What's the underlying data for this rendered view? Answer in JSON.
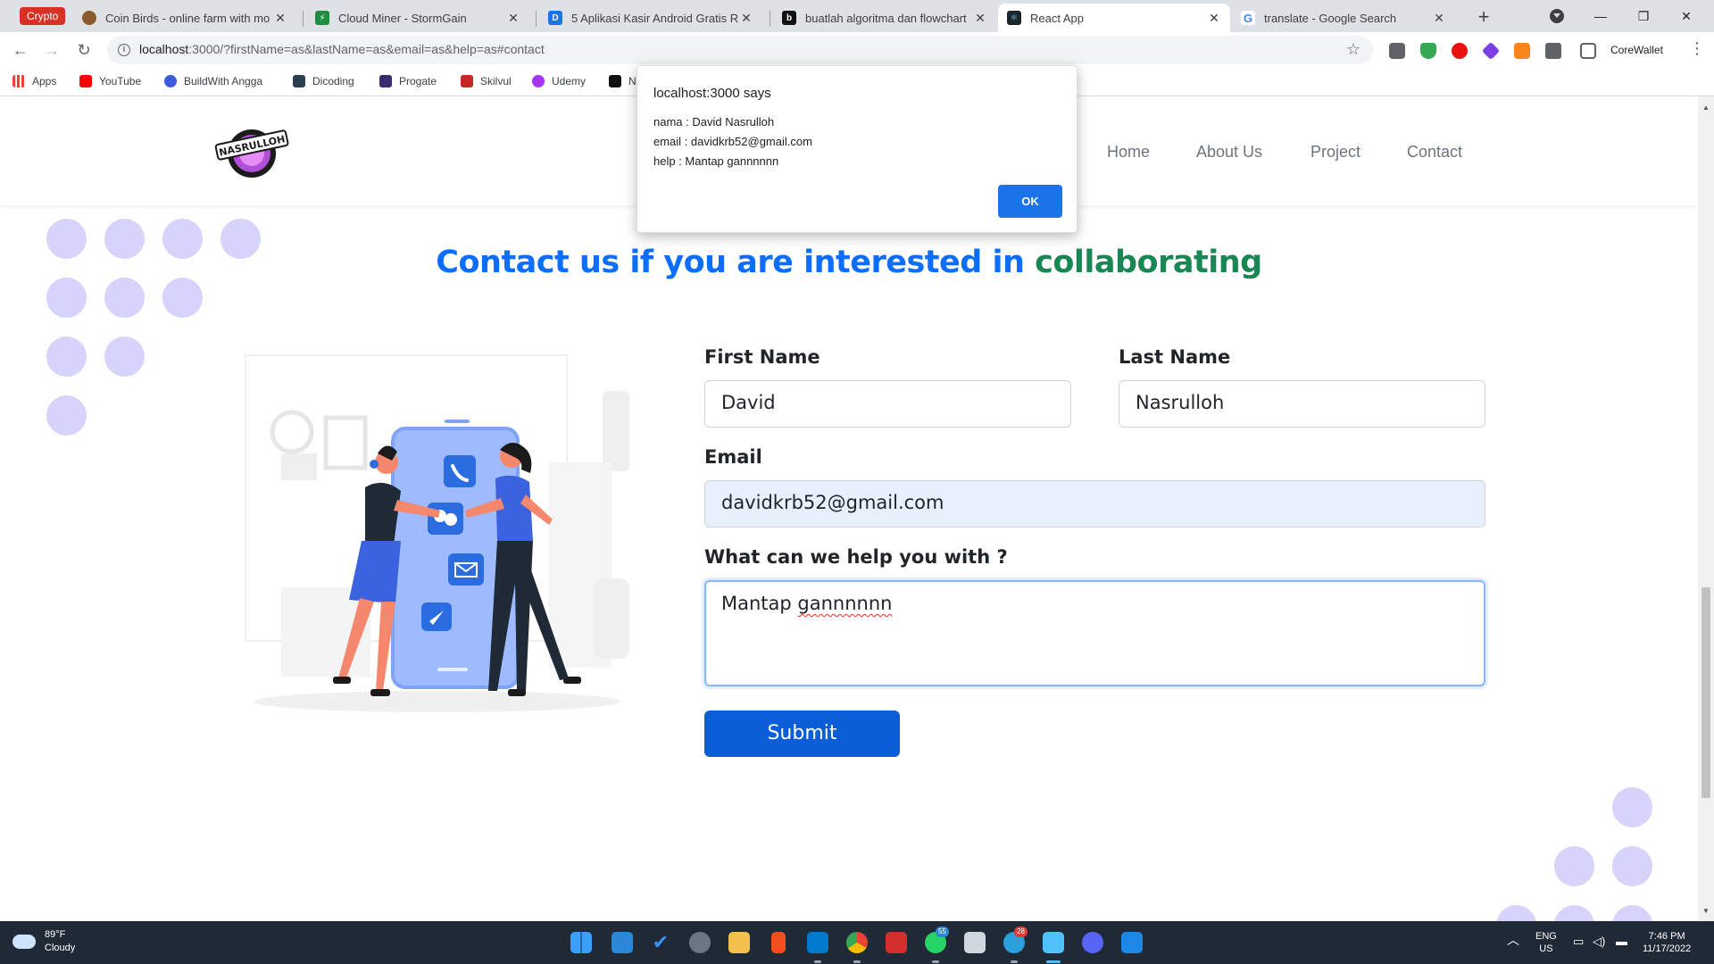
{
  "browser": {
    "tab_group": "Crypto",
    "tabs": [
      {
        "title": "Coin Birds - online farm with mo",
        "favicon_color": "#8b5a2b"
      },
      {
        "title": "Cloud Miner - StormGain",
        "favicon_color": "#1e8e3e"
      },
      {
        "title": "5 Aplikasi Kasir Android Gratis R",
        "favicon_color": "#1a73e8"
      },
      {
        "title": "buatlah algoritma dan flowchart",
        "favicon_color": "#111111"
      },
      {
        "title": "React App",
        "favicon_color": "#20232a"
      },
      {
        "title": "translate - Google Search",
        "favicon_color": "#4285f4"
      }
    ],
    "url_host": "localhost",
    "url_rest": ":3000/?firstName=as&lastName=as&email=as&help=as#contact",
    "profile_label": "CoreWallet",
    "bookmarks": [
      {
        "label": "Apps",
        "color": "#ea4335"
      },
      {
        "label": "YouTube",
        "color": "#ff0000"
      },
      {
        "label": "BuildWith Angga",
        "color": "#3b5bdb"
      },
      {
        "label": "Dicoding",
        "color": "#2d3e50"
      },
      {
        "label": "Progate",
        "color": "#3a2a6d"
      },
      {
        "label": "Skilvul",
        "color": "#c62828"
      },
      {
        "label": "Udemy",
        "color": "#a435f0"
      },
      {
        "label": "N",
        "color": "#111111"
      }
    ]
  },
  "alert": {
    "title": "localhost:3000 says",
    "lines": [
      "nama : David Nasrulloh",
      "email : davidkrb52@gmail.com",
      "help : Mantap gannnnnn"
    ],
    "ok_label": "OK"
  },
  "site": {
    "logo_text": "NASRULLOH",
    "nav": [
      "Home",
      "About Us",
      "Project",
      "Contact"
    ],
    "heading_blue": "Contact us if you are interested in",
    "heading_green": "collaborating",
    "form": {
      "first_name_label": "First Name",
      "first_name_value": "David",
      "last_name_label": "Last Name",
      "last_name_value": "Nasrulloh",
      "email_label": "Email",
      "email_value": "davidkrb52@gmail.com",
      "help_label": "What can we help you with ?",
      "help_value_word1": "Mantap",
      "help_value_word2": "gannnnnn",
      "submit_label": "Submit"
    },
    "colors": {
      "primary": "#0d6efd",
      "accent_green": "#198754",
      "dots": "#d6d4fb"
    }
  },
  "taskbar": {
    "temperature": "89°F",
    "condition": "Cloudy",
    "language": "ENG",
    "region": "US",
    "time": "7:46 PM",
    "date": "11/17/2022",
    "badges": {
      "whatsapp": "55",
      "telegram": "28"
    }
  }
}
